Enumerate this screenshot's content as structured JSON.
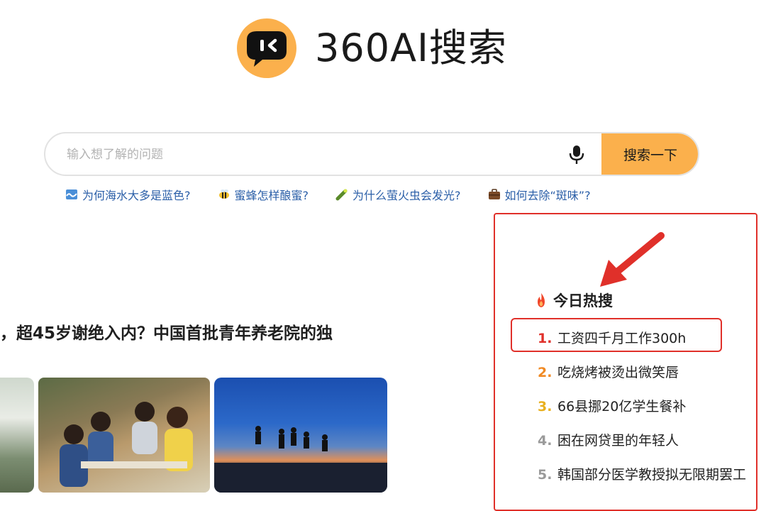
{
  "brand": {
    "name": "360AI搜索",
    "logo_color": "#fbb04c"
  },
  "search": {
    "placeholder": "输入想了解的问题",
    "button_label": "搜索一下",
    "mic_icon": "microphone-icon"
  },
  "suggestions": [
    {
      "icon": "wave-icon",
      "label": "为何海水大多是蓝色?"
    },
    {
      "icon": "bee-icon",
      "label": "蜜蜂怎样酿蜜?"
    },
    {
      "icon": "firefly-icon",
      "label": "为什么萤火虫会发光?"
    },
    {
      "icon": "briefcase-icon",
      "label": "如何去除“斑味”?"
    }
  ],
  "news": {
    "headline": "，超45岁谢绝入内？中国首批青年养老院的独"
  },
  "hot_search": {
    "title": "今日热搜",
    "items": [
      {
        "rank": "1.",
        "text": "工资四千月工作300h",
        "rank_color": "#e0302a"
      },
      {
        "rank": "2.",
        "text": "吃烧烤被烫出微笑唇",
        "rank_color": "#f08a24"
      },
      {
        "rank": "3.",
        "text": "66县挪20亿学生餐补",
        "rank_color": "#e8b020"
      },
      {
        "rank": "4.",
        "text": "困在网贷里的年轻人",
        "rank_color": "#9a9a9a"
      },
      {
        "rank": "5.",
        "text": "韩国部分医学教授拟无限期罢工",
        "rank_color": "#9a9a9a"
      }
    ],
    "annotation_color": "#e0302a"
  }
}
